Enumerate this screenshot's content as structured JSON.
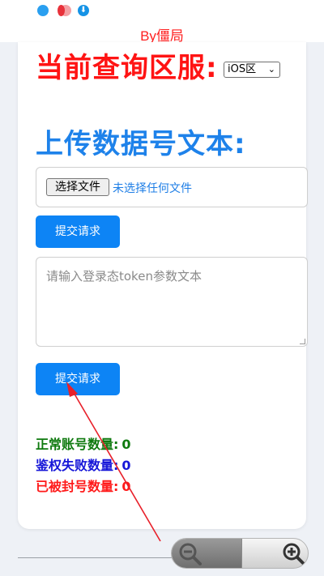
{
  "status_bar": {
    "icons": [
      "qq-icon",
      "notification-dot-icon",
      "download-icon"
    ]
  },
  "byline": "By僵局",
  "region": {
    "heading": "当前查询区服:",
    "selected": "iOS区"
  },
  "upload": {
    "heading": "上传数据号文本:",
    "file_button": "选择文件",
    "file_status": "未选择任何文件",
    "submit_label": "提交请求"
  },
  "token": {
    "placeholder": "请输入登录态token参数文本",
    "submit_label": "提交请求"
  },
  "stats": {
    "normal": {
      "label": "正常账号数量:",
      "value": "0"
    },
    "auth_fail": {
      "label": "鉴权失败数量:",
      "value": "0"
    },
    "banned": {
      "label": "已被封号数量:",
      "value": "0"
    }
  },
  "colors": {
    "region_heading": "#ff1414",
    "upload_heading": "#1e82ea",
    "button": "#0d84f5",
    "stat_normal": "#0f7a0f",
    "stat_auth_fail": "#1616d8",
    "stat_banned": "#ff1a1a",
    "annotation_arrow": "#e8202a"
  },
  "zoom_controls": {
    "icons": [
      "zoom-out-icon",
      "zoom-in-icon"
    ]
  }
}
